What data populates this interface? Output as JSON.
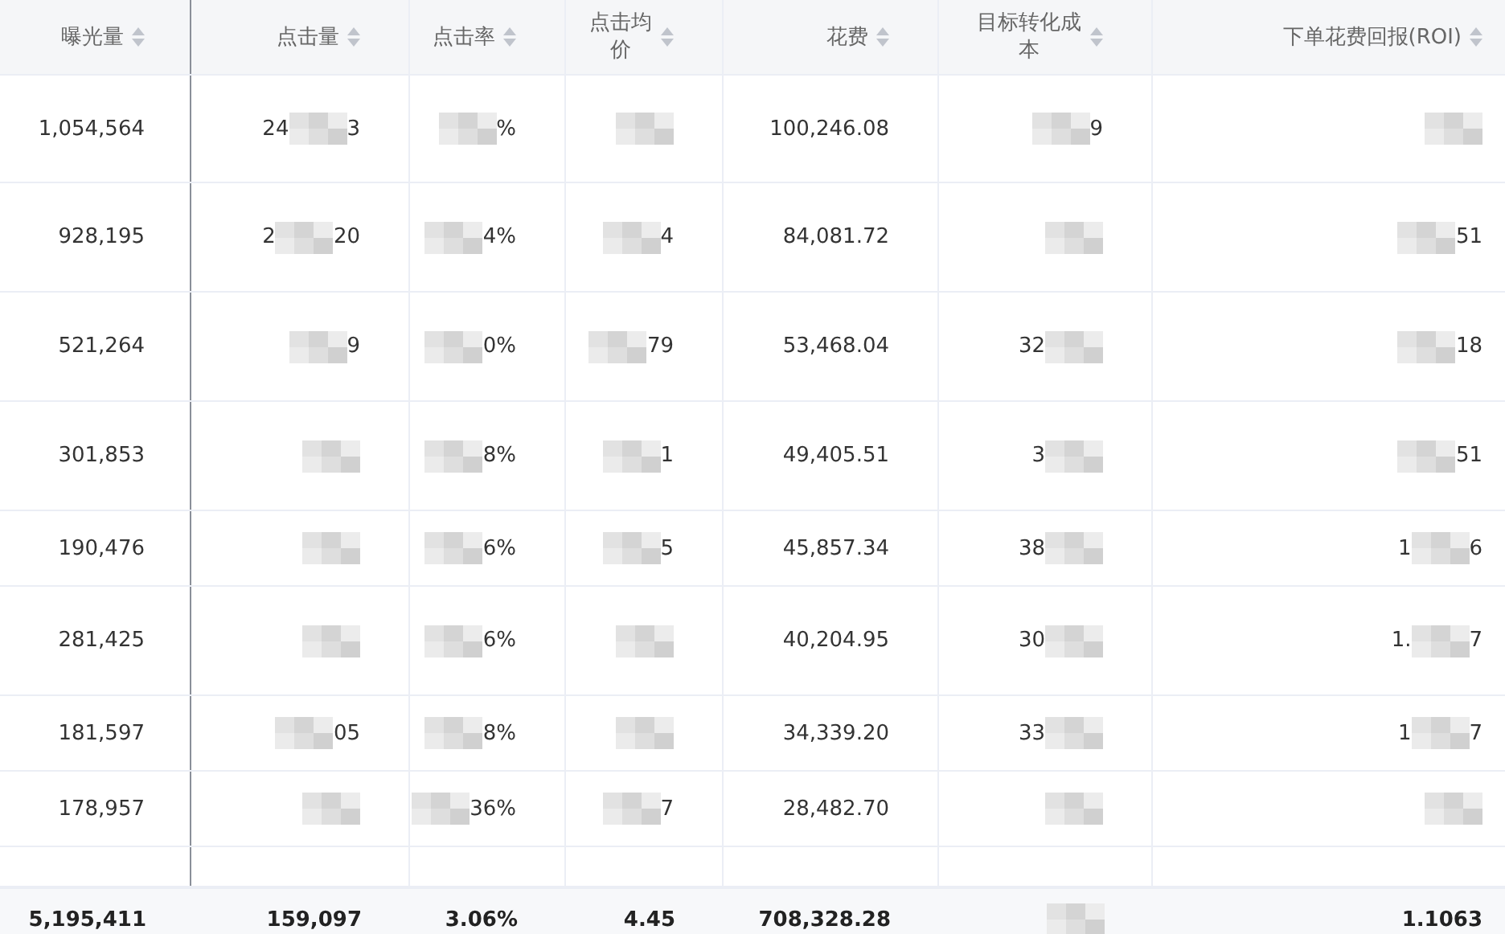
{
  "table": {
    "columns": [
      {
        "label": "曝光量"
      },
      {
        "label": "点击量"
      },
      {
        "label": "点击率"
      },
      {
        "label": "点击均价"
      },
      {
        "label": "花费"
      },
      {
        "label": "目标转化成本"
      },
      {
        "label": "下单花费回报(ROI)"
      }
    ],
    "rows": [
      [
        {
          "kind": "text",
          "text": "1,054,564"
        },
        {
          "kind": "mosaic",
          "before": "24",
          "after": "3"
        },
        {
          "kind": "mosaic",
          "after": "%"
        },
        {
          "kind": "mosaic"
        },
        {
          "kind": "text",
          "text": "100,246.08"
        },
        {
          "kind": "mosaic",
          "after": "9"
        },
        {
          "kind": "mosaic"
        }
      ],
      [
        {
          "kind": "text",
          "text": "928,195"
        },
        {
          "kind": "mosaic",
          "before": "2",
          "after": "20"
        },
        {
          "kind": "mosaic",
          "after": "4%"
        },
        {
          "kind": "mosaic",
          "after": "4"
        },
        {
          "kind": "text",
          "text": "84,081.72"
        },
        {
          "kind": "mosaic"
        },
        {
          "kind": "mosaic",
          "after": "51"
        }
      ],
      [
        {
          "kind": "text",
          "text": "521,264"
        },
        {
          "kind": "mosaic",
          "after": "9"
        },
        {
          "kind": "mosaic",
          "after": "0%"
        },
        {
          "kind": "mosaic",
          "after": "79"
        },
        {
          "kind": "text",
          "text": "53,468.04"
        },
        {
          "kind": "mosaic",
          "before": "32"
        },
        {
          "kind": "mosaic",
          "after": "18"
        }
      ],
      [
        {
          "kind": "text",
          "text": "301,853"
        },
        {
          "kind": "mosaic"
        },
        {
          "kind": "mosaic",
          "after": "8%"
        },
        {
          "kind": "mosaic",
          "after": "1"
        },
        {
          "kind": "text",
          "text": "49,405.51"
        },
        {
          "kind": "mosaic",
          "before": "3"
        },
        {
          "kind": "mosaic",
          "after": "51"
        }
      ],
      [
        {
          "kind": "text",
          "text": "190,476"
        },
        {
          "kind": "mosaic"
        },
        {
          "kind": "mosaic",
          "after": "6%"
        },
        {
          "kind": "mosaic",
          "after": "5"
        },
        {
          "kind": "text",
          "text": "45,857.34"
        },
        {
          "kind": "mosaic",
          "before": "38"
        },
        {
          "kind": "mosaic",
          "before": "1",
          "after": "6"
        }
      ],
      [
        {
          "kind": "text",
          "text": "281,425"
        },
        {
          "kind": "mosaic"
        },
        {
          "kind": "mosaic",
          "after": "6%"
        },
        {
          "kind": "mosaic"
        },
        {
          "kind": "text",
          "text": "40,204.95"
        },
        {
          "kind": "mosaic",
          "before": "30"
        },
        {
          "kind": "mosaic",
          "before": "1.",
          "after": "7"
        }
      ],
      [
        {
          "kind": "text",
          "text": "181,597"
        },
        {
          "kind": "mosaic",
          "after": "05"
        },
        {
          "kind": "mosaic",
          "after": "8%"
        },
        {
          "kind": "mosaic"
        },
        {
          "kind": "text",
          "text": "34,339.20"
        },
        {
          "kind": "mosaic",
          "before": "33"
        },
        {
          "kind": "mosaic",
          "before": "1",
          "after": "7"
        }
      ],
      [
        {
          "kind": "text",
          "text": "178,957"
        },
        {
          "kind": "mosaic"
        },
        {
          "kind": "mosaic",
          "after": "36%"
        },
        {
          "kind": "mosaic",
          "after": "7"
        },
        {
          "kind": "text",
          "text": "28,482.70"
        },
        {
          "kind": "mosaic"
        },
        {
          "kind": "mosaic"
        }
      ]
    ],
    "totals": [
      {
        "kind": "text",
        "text": "5,195,411"
      },
      {
        "kind": "text",
        "text": "159,097"
      },
      {
        "kind": "text",
        "text": "3.06%"
      },
      {
        "kind": "text",
        "text": "4.45"
      },
      {
        "kind": "text",
        "text": "708,328.28"
      },
      {
        "kind": "mosaic"
      },
      {
        "kind": "text",
        "text": "1.1063"
      }
    ]
  }
}
